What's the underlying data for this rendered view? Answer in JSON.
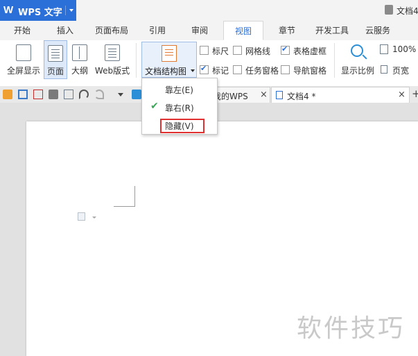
{
  "app": {
    "logo": "W",
    "name": "WPS 文字",
    "doc_title": "文档4"
  },
  "menu": {
    "tabs": [
      {
        "label": "开始"
      },
      {
        "label": "插入"
      },
      {
        "label": "页面布局"
      },
      {
        "label": "引用"
      },
      {
        "label": "审阅"
      },
      {
        "label": "视图"
      },
      {
        "label": "章节"
      },
      {
        "label": "开发工具"
      },
      {
        "label": "云服务"
      }
    ],
    "active": "视图"
  },
  "ribbon": {
    "fullscreen": "全屏显示",
    "page": "页面",
    "outline": "大纲",
    "web": "Web版式",
    "docmap": "文档结构图",
    "ruler": "标尺",
    "gridlines": "网格线",
    "table_gridlines": "表格虚框",
    "marks": "标记",
    "task_pane": "任务窗格",
    "nav_pane": "导航窗格",
    "zoom": "显示比例",
    "zoom_pct": "100%",
    "page_width": "页宽"
  },
  "tabs_bar": {
    "tab1": "我的WPS",
    "tab2": "文档4 *",
    "close": "×",
    "add": "+"
  },
  "dropdown": {
    "items": [
      {
        "label": "靠左(E)",
        "checked": false
      },
      {
        "label": "靠右(R)",
        "checked": true
      },
      {
        "label": "隐藏(V)",
        "checked": false
      }
    ],
    "check_mark": "✔"
  },
  "watermark": "软件技巧",
  "colors": {
    "accent": "#2b6fd8",
    "highlight_box": "#e03030",
    "check": "#3aa856"
  }
}
